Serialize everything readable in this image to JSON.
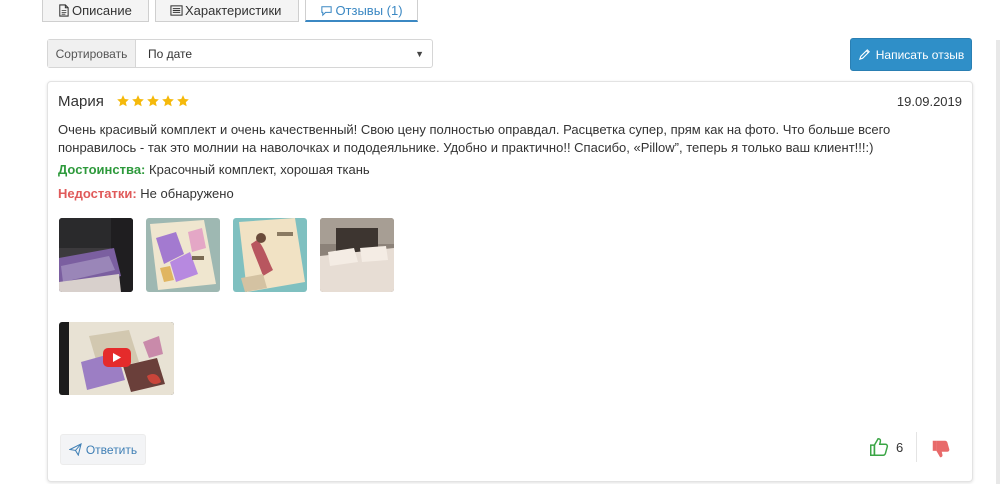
{
  "tabs": [
    {
      "label": "Описание",
      "icon": "document-icon"
    },
    {
      "label": "Характеристики",
      "icon": "list-icon"
    },
    {
      "label": "Отзывы (1)",
      "icon": "comment-icon",
      "active": true
    }
  ],
  "sort": {
    "label": "Сортировать",
    "selected": "По дате"
  },
  "write_review_button": "Написать отзыв",
  "review": {
    "author": "Мария",
    "rating": 5,
    "rating_max": 5,
    "date": "19.09.2019",
    "text_line1": "Очень красивый комплект и очень качественный! Свою цену полностью оправдал. Расцветка супер, прям как на фото. Что больше всего",
    "text_line2": "понравилось - так это молнии на наволочках и пододеяльнике. Удобно и практично!! Спасибо, «Pillow”, теперь я только ваш клиент!!!:)",
    "pros_label": "Достоинства:",
    "pros_text": "Красочный комплект, хорошая ткань",
    "cons_label": "Недостатки:",
    "cons_text": "Не обнаружено",
    "photo_count": 4,
    "reply_label": "Ответить",
    "likes": "6"
  },
  "colors": {
    "accent": "#2f8fc8",
    "pros": "#2e9a3c",
    "cons": "#e05a5a",
    "star": "#f5b90b",
    "like": "#3aa545",
    "dislike": "#e86a6a"
  }
}
